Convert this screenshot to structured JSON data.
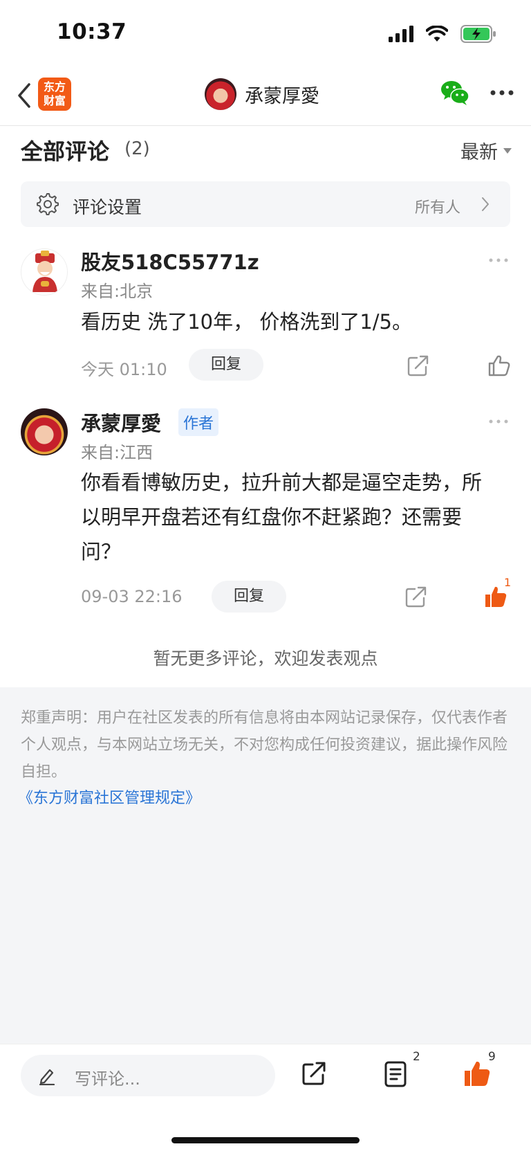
{
  "status_bar": {
    "time": "10:37"
  },
  "nav": {
    "logo_line1": "东方",
    "logo_line2": "财富",
    "title": "承蒙厚愛"
  },
  "comments_header": {
    "title": "全部评论",
    "count": "(2)",
    "sort_label": "最新"
  },
  "settings_row": {
    "label": "评论设置",
    "value": "所有人"
  },
  "comments": [
    {
      "name": "股友518C55771z",
      "location": "来自:北京",
      "text": "看历史 洗了10年， 价格洗到了1/5。",
      "time": "今天 01:10",
      "reply_label": "回复"
    },
    {
      "name": "承蒙厚愛",
      "badge": "作者",
      "location": "来自:江西",
      "text": "你看看博敏历史，拉升前大都是逼空走势，所以明早开盘若还有红盘你不赶紧跑？还需要问？",
      "time": "09-03 22:16",
      "reply_label": "回复",
      "like_count": "1"
    }
  ],
  "no_more_text": "暂无更多评论，欢迎发表观点",
  "disclaimer": "郑重声明：用户在社区发表的所有信息将由本网站记录保存，仅代表作者个人观点，与本网站立场无关，不对您构成任何投资建议，据此操作风险自担。",
  "rules_link": "《东方财富社区管理规定》",
  "bottom_bar": {
    "input_placeholder": "写评论...",
    "comment_count": "2",
    "like_count": "9"
  },
  "colors": {
    "accent_orange": "#ee5a14",
    "link_blue": "#2a75d6",
    "battery_green": "#34c759",
    "wechat_green": "#1aad19"
  }
}
